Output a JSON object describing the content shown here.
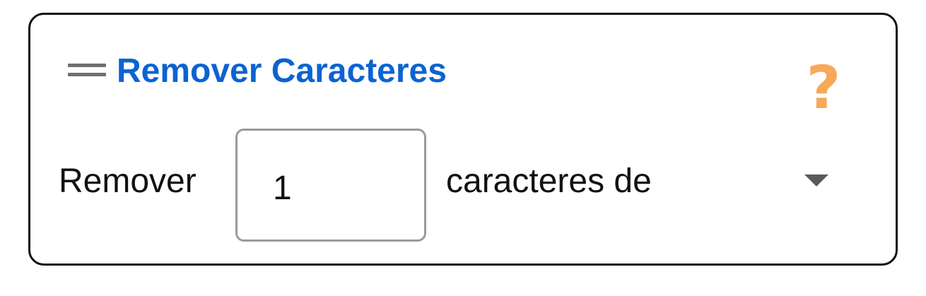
{
  "block": {
    "title": "Remover Caracteres",
    "help_icon": "question-mark-icon",
    "help_symbol": "?",
    "drag_icon": "drag-handle-icon",
    "label_before": "Remover",
    "count_value": "1",
    "label_after": "caracteres de",
    "position_dropdown": {
      "icon": "dropdown-triangle-icon",
      "selected": ""
    }
  },
  "colors": {
    "title": "#0b63d2",
    "help": "#f7a95a",
    "border": "#111111",
    "input_border": "#9a9a9a",
    "drag_handle": "#6f6f6f",
    "dropdown_arrow": "#5a5a5a"
  }
}
